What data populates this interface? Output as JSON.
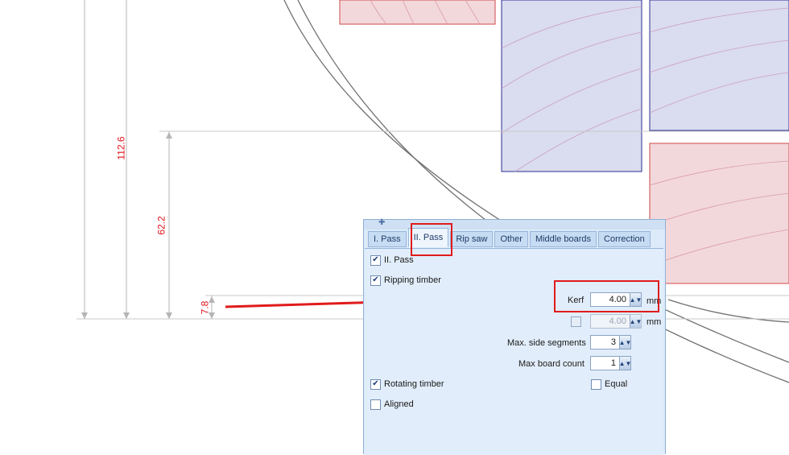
{
  "dimensions": {
    "d1": "112.6",
    "d2": "62.2",
    "d3": "7.8"
  },
  "colors": {
    "dimension_text": "#e0101a",
    "annotation": "#e01b1b"
  },
  "tabs": [
    {
      "label": "I. Pass"
    },
    {
      "label": "II. Pass",
      "active": true
    },
    {
      "label": "Rip saw"
    },
    {
      "label": "Other"
    },
    {
      "label": "Middle boards"
    },
    {
      "label": "Correction"
    }
  ],
  "form": {
    "second_pass": {
      "label": "II. Pass",
      "checked": true
    },
    "ripping_timber": {
      "label": "Ripping timber",
      "checked": true
    },
    "kerf": {
      "label": "Kerf",
      "value": "4.00",
      "unit": "mm"
    },
    "kerf2": {
      "value": "4.00",
      "unit": "mm",
      "checked": false
    },
    "max_side_segments": {
      "label": "Max. side segments",
      "value": "3"
    },
    "max_board_count": {
      "label": "Max board count",
      "value": "1"
    },
    "rotating_timber": {
      "label": "Rotating timber",
      "checked": true
    },
    "equal": {
      "label": "Equal",
      "checked": false
    },
    "aligned": {
      "label": "Aligned",
      "checked": false
    }
  }
}
